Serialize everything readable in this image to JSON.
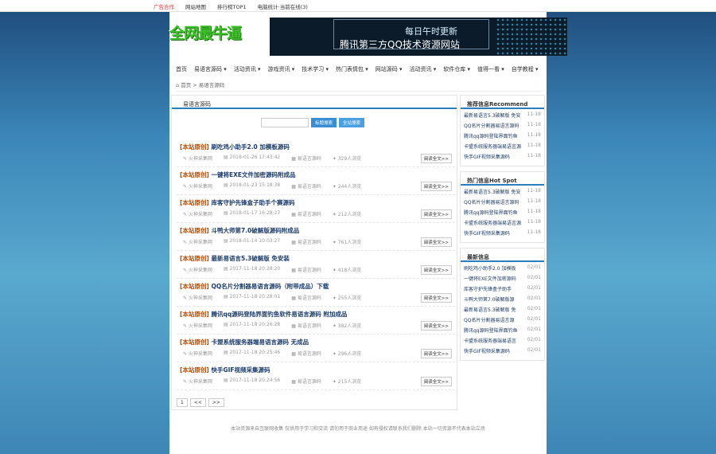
{
  "topbar": {
    "links": [
      "广告合作",
      "网站地图",
      "排行榜TOP1",
      "电脑统计·当前在线(3)"
    ]
  },
  "logo": {
    "main": "全网最牛逼"
  },
  "banner": {
    "line1": "每日午时更新",
    "line2": "腾讯第三方QQ技术资源网站"
  },
  "nav": [
    "首页",
    "易语言源码 ▾",
    "活动资讯 ▾",
    "游戏资讯 ▾",
    "技术学习 ▾",
    "热门表情包 ▾",
    "网站源码 ▾",
    "活动资讯 ▾",
    "软件仓库 ▾",
    "值得一看 ▾",
    "自学教程 ▾"
  ],
  "crumb": "首页 > 易语言源码",
  "main": {
    "title": "易语言源码",
    "search_placeholder": "",
    "btn1": "标题搜索",
    "btn2": "全站搜索",
    "items": [
      {
        "tag": "[本站原创]",
        "title": "刷吃鸡小助手2.0 加模板源码",
        "author": "火神采集网",
        "date": "2018-01-26 17:43:42",
        "cat": "易语言源码",
        "views": "329人浏览",
        "more": "阅读全文>>"
      },
      {
        "tag": "[本站原创]",
        "title": "一键将EXE文件加密源码附成品",
        "author": "火神采集网",
        "date": "2018-01-23 15:18:38",
        "cat": "易语言源码",
        "views": "244人浏览",
        "more": "阅读全文>>"
      },
      {
        "tag": "[本站原创]",
        "title": "库客守护先锋盒子助手个赛源码",
        "author": "火神采集网",
        "date": "2018-01-17 16:28:27",
        "cat": "易语言源码",
        "views": "212人浏览",
        "more": "阅读全文>>"
      },
      {
        "tag": "[本站原创]",
        "title": "斗鸭大师第7.0破解版源码附成品",
        "author": "火神采集网",
        "date": "2018-01-14 10:03:27",
        "cat": "易语言源码",
        "views": "761人浏览",
        "more": "阅读全文>>"
      },
      {
        "tag": "[本站原创]",
        "title": "最新易语言5.3破解版 免安装",
        "author": "火神采集网",
        "date": "2017-11-18 20:28:20",
        "cat": "易语言源码",
        "views": "418人浏览",
        "more": "阅读全文>>"
      },
      {
        "tag": "[本站原创]",
        "title": "QQ名片分割器易语言源码（附带成品）下载",
        "author": "火神采集网",
        "date": "2017-11-18 20:28:01",
        "cat": "易语言源码",
        "views": "255人浏览",
        "more": "阅读全文>>"
      },
      {
        "tag": "[本站原创]",
        "title": "腾讯qq源码登陆界面钓鱼软件易语言源码 附加成品",
        "author": "火神采集网",
        "date": "2017-11-18 20:26:28",
        "cat": "易语言源码",
        "views": "382人浏览",
        "more": "阅读全文>>"
      },
      {
        "tag": "[本站原创]",
        "title": "卡盟系统服务器端易语言源码 无成品",
        "author": "火神采集网",
        "date": "2017-11-18 20:25:46",
        "cat": "易语言源码",
        "views": "296人浏览",
        "more": "阅读全文>>"
      },
      {
        "tag": "[本站原创]",
        "title": "快手GIF视频采集源码",
        "author": "火神采集网",
        "date": "2017-11-18 20:24:56",
        "cat": "易语言源码",
        "views": "215人浏览",
        "more": "阅读全文>>"
      }
    ],
    "pager": [
      "1",
      "<<",
      ">>"
    ]
  },
  "side": {
    "rec": {
      "title": "推荐信息Recommend",
      "items": [
        {
          "t": "最新易语言5.3破解版 免安",
          "d": "11-18"
        },
        {
          "t": "QQ名片分割器易语言源码",
          "d": "11-18"
        },
        {
          "t": "腾讯qq源码登陆界面钓鱼",
          "d": "11-18"
        },
        {
          "t": "卡盟系统服务器端易语言源",
          "d": "11-18"
        },
        {
          "t": "快手GIF视频采集源码",
          "d": "11-18"
        }
      ]
    },
    "hot": {
      "title": "热门信息Hot Spot",
      "items": [
        {
          "t": "最新易语言5.3破解版 免安",
          "d": "11-18"
        },
        {
          "t": "QQ名片分割器易语言源码",
          "d": "11-18"
        },
        {
          "t": "腾讯qq源码登陆界面钓鱼",
          "d": "11-18"
        },
        {
          "t": "卡盟系统服务器端易语言源",
          "d": "11-18"
        },
        {
          "t": "快手GIF视频采集源码",
          "d": "11-18"
        }
      ]
    },
    "latest": {
      "title": "最新信息",
      "items": [
        {
          "t": "刷吃鸡小助手2.0 加模板",
          "d": "02/01"
        },
        {
          "t": "一键将EXE文件加密源码",
          "d": "02/01"
        },
        {
          "t": "库客守护先锋盒子助手",
          "d": "02/01"
        },
        {
          "t": "斗鸭大师第7.0破解版源",
          "d": "02/01"
        },
        {
          "t": "最新易语言5.3破解版 免",
          "d": "02/01"
        },
        {
          "t": "QQ名片分割器易语言源",
          "d": "02/01"
        },
        {
          "t": "腾讯qq源码登陆界面钓鱼",
          "d": "02/01"
        },
        {
          "t": "卡盟系统服务器端易语言",
          "d": "02/01"
        },
        {
          "t": "快手GIF视频采集源码",
          "d": "02/01"
        }
      ]
    }
  },
  "footer": "本站资源来自互联网收集 仅供用于学习和交流 请勿用于商业用途 如有侵权请联系我们删除 本站一切资源不代表本站立场"
}
